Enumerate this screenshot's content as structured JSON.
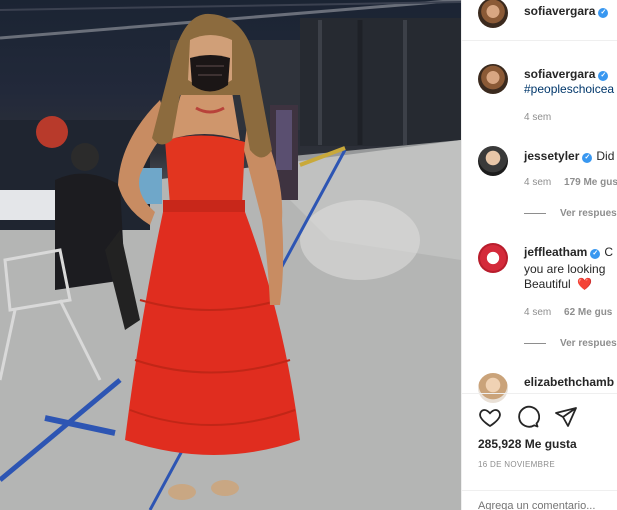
{
  "post": {
    "author": "sofiavergara",
    "author_verified": true,
    "caption_hashtag": "#peopleschoicea",
    "caption_time": "4 sem",
    "likes": "285,928 Me gusta",
    "date": "16 DE NOVIEMBRE",
    "add_comment_placeholder": "Agrega un comentario..."
  },
  "comments": [
    {
      "user": "jessetyler",
      "verified": true,
      "text": "Did",
      "time": "4 sem",
      "likes": "179 Me gus",
      "replies": "Ver respues"
    },
    {
      "user": "jeffleatham",
      "verified": true,
      "text_1": "C",
      "text_2": "you are looking",
      "text_3": "Beautiful",
      "emoji": "❤️",
      "time": "4 sem",
      "likes": "62 Me gus",
      "replies": "Ver respues"
    },
    {
      "user": "elizabethchamb"
    }
  ],
  "icons": [
    "heart-icon",
    "comment-icon",
    "share-icon",
    "verified-icon"
  ],
  "colors": {
    "dress": "#e02d1f",
    "verified": "#3897f0",
    "hashtag": "#00376b",
    "heart_emoji": "#ed1c24"
  }
}
